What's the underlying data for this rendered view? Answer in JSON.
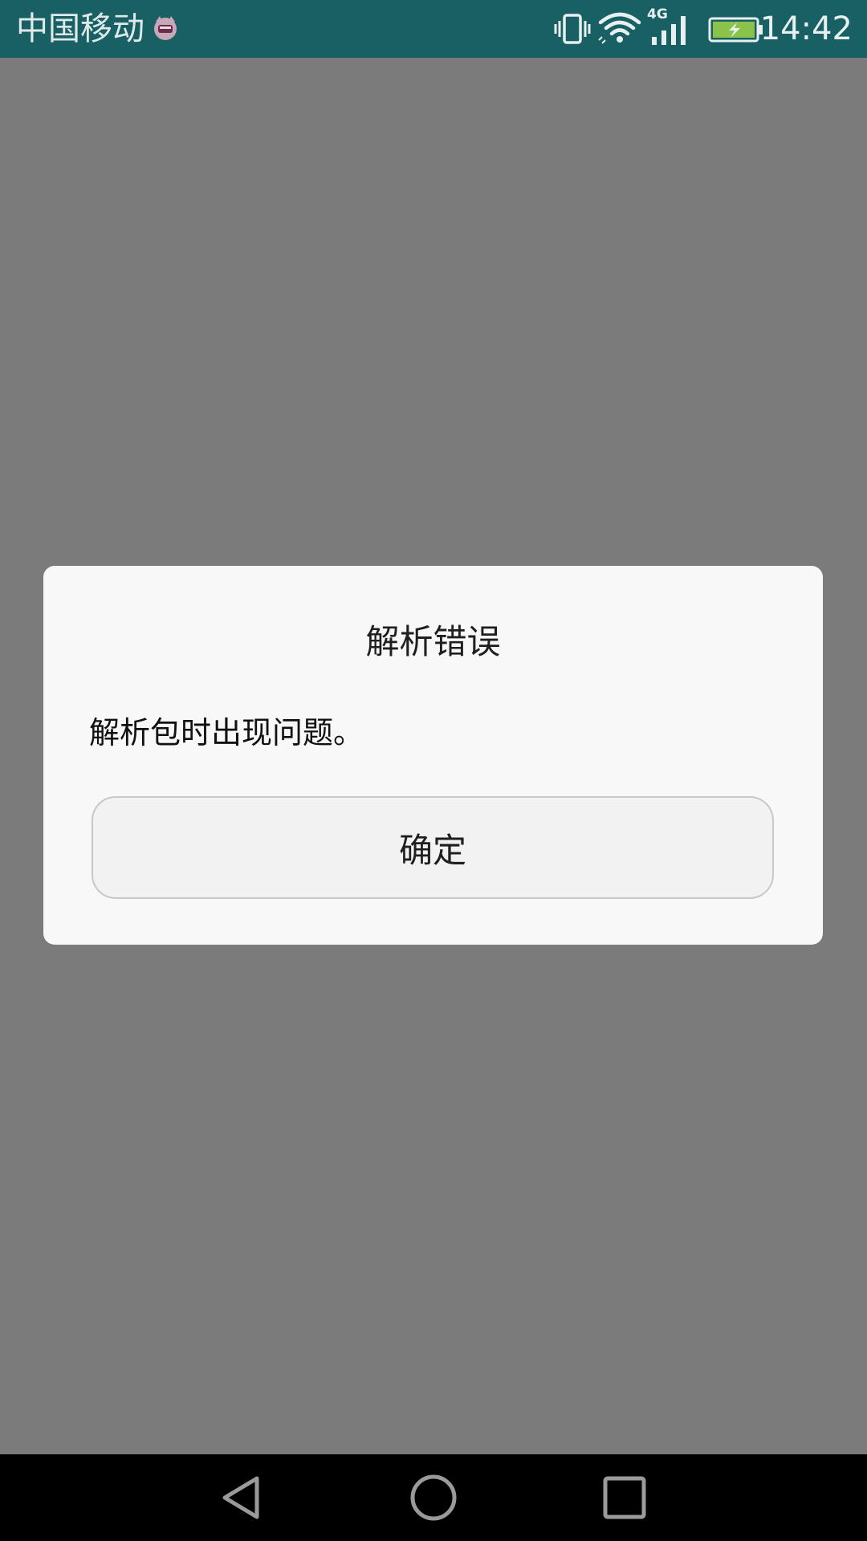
{
  "status_bar": {
    "carrier": "中国移动",
    "network_type": "4G",
    "time": "14:42",
    "icons": [
      "app-notification-icon",
      "vibrate-icon",
      "wifi-icon",
      "cell-signal-icon",
      "battery-charging-icon"
    ]
  },
  "dialog": {
    "title": "解析错误",
    "message": "解析包时出现问题。",
    "ok_label": "确定"
  },
  "nav_bar": {
    "icons": [
      "back-icon",
      "home-icon",
      "recents-icon"
    ]
  },
  "colors": {
    "status_bar_bg": "#186064",
    "scrim": "#7b7b7b",
    "dialog_bg": "#f8f8f8",
    "nav_bar_bg": "#000000"
  }
}
